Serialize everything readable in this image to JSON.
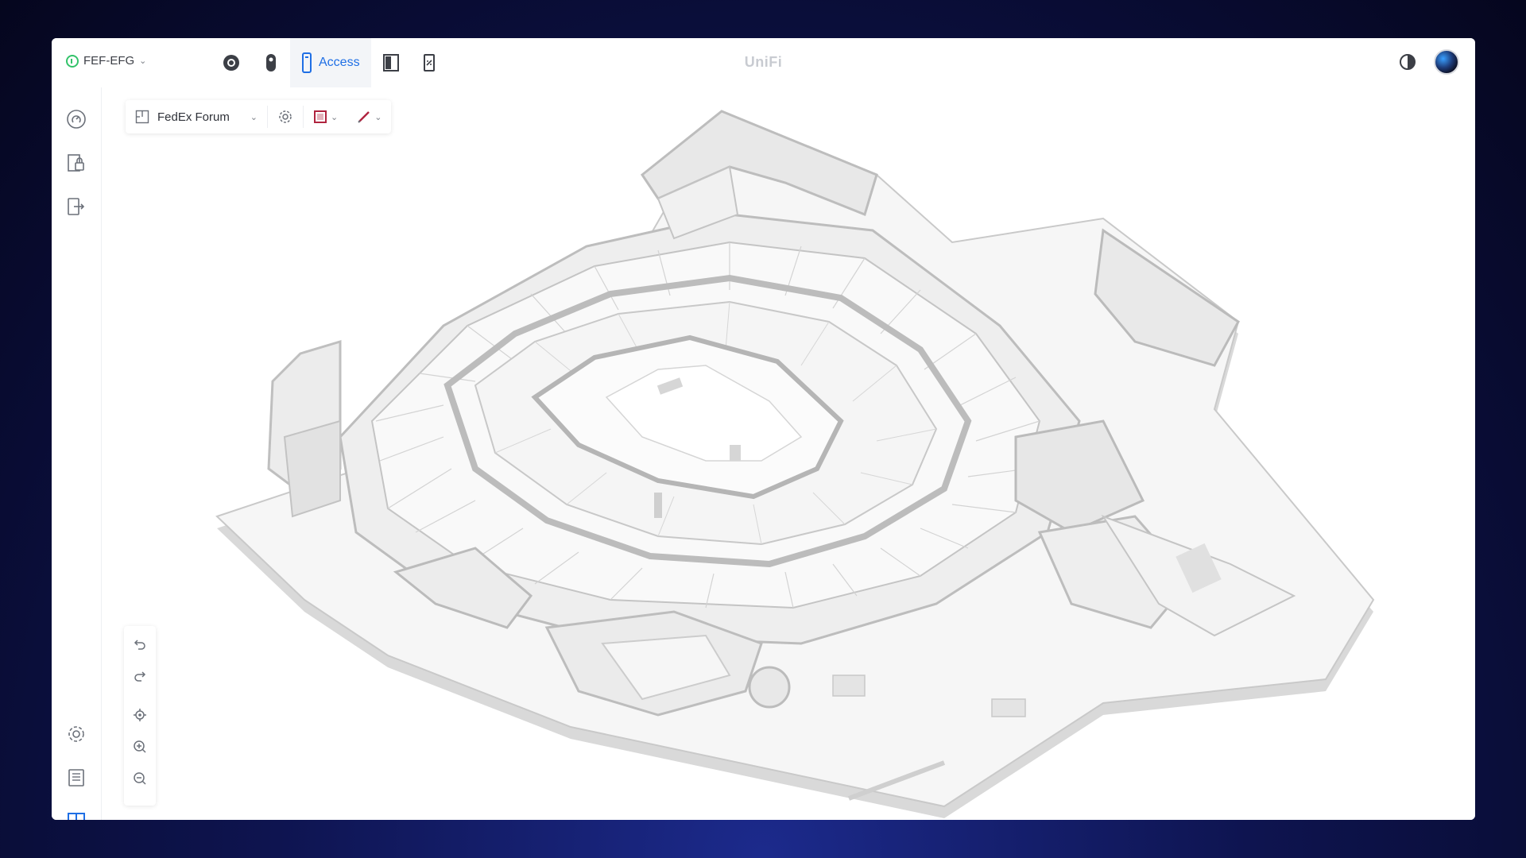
{
  "header": {
    "site_name": "FEF-EFG",
    "brand": "UniFi",
    "apps": [
      {
        "icon": "protect-camera-icon"
      },
      {
        "icon": "talk-intercom-icon"
      },
      {
        "icon": "access-phone-icon",
        "label": "Access"
      },
      {
        "icon": "door-panel-icon"
      },
      {
        "icon": "connect-device-icon"
      }
    ],
    "right_icons": [
      "theme-toggle-icon",
      "user-avatar"
    ]
  },
  "sidebar": {
    "items": [
      "dashboard-icon",
      "door-lock-icon",
      "exit-device-icon",
      "settings-icon",
      "logs-icon",
      "floorplan-icon"
    ]
  },
  "toolbar": {
    "floor_name": "FedEx Forum",
    "icons": [
      "floorplan-select-icon",
      "map-settings-icon",
      "draw-shape-icon",
      "pen-tool-icon"
    ]
  },
  "map_controls": [
    "undo-icon",
    "redo-icon",
    "locate-icon",
    "zoom-in-icon",
    "zoom-out-icon"
  ],
  "colors": {
    "accent": "#1f6fe5",
    "status_online": "#33c36a",
    "background_dark": "#0e1450",
    "model_wall": "#e3e3e3",
    "model_floor": "#f4f4f4"
  }
}
